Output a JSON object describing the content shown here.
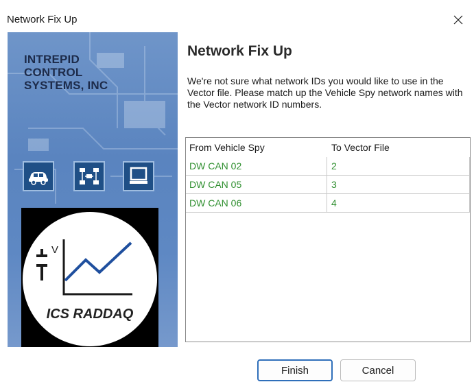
{
  "window": {
    "title": "Network Fix Up",
    "close_icon": "close-icon"
  },
  "banner": {
    "company_name": "INTREPID\nCONTROL\nSYSTEMS, INC",
    "icons": [
      "car-icon",
      "network-icon",
      "computer-icon"
    ],
    "logo_text": "ICS RADDAQ",
    "logo_symbol_superscript": "V"
  },
  "content": {
    "heading": "Network Fix Up",
    "description": "We're not sure what network IDs you would like to use in the Vector file. Please match up the Vehicle Spy network names with the Vector network ID numbers."
  },
  "table": {
    "columns": [
      "From Vehicle Spy",
      "To Vector File"
    ],
    "rows": [
      [
        "DW CAN 02",
        "2"
      ],
      [
        "DW CAN 05",
        "3"
      ],
      [
        "DW CAN 06",
        "4"
      ]
    ],
    "row_text_color": "#2f8f2f"
  },
  "buttons": {
    "finish_label": "Finish",
    "cancel_label": "Cancel"
  },
  "colors": {
    "accent": "#2f6fba",
    "banner_blue": "#5e88c3"
  }
}
